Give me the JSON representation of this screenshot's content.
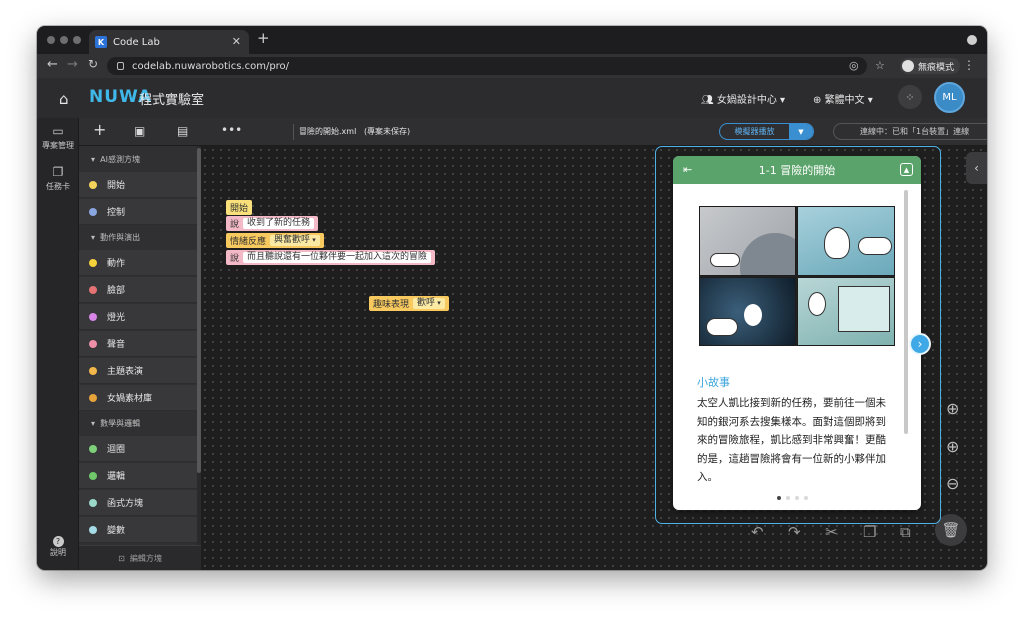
{
  "browser": {
    "tab_title": "Code Lab",
    "tab_favicon": "K",
    "url": "codelab.nuwarobotics.com/pro/",
    "incognito_label": "無痕模式"
  },
  "header": {
    "logo": "NUWA",
    "app_name": "程式實驗室",
    "design_center": "女媧設計中心",
    "language": "繁體中文",
    "avatar": "ML"
  },
  "leftnav": {
    "project_manager": "專案管理",
    "task_card": "任務卡",
    "help": "說明"
  },
  "toolbar": {
    "filename": "冒險的開始.xml",
    "unsaved": "(專案未保存)",
    "simulator": "模擬器播放",
    "connection": "連線中：已和「1台裝置」連線"
  },
  "categories": {
    "group1": "AI感測方塊",
    "group2": "動作與演出",
    "group3": "數學與邏輯",
    "items": [
      {
        "label": "開始",
        "color": "#f5d25b"
      },
      {
        "label": "控制",
        "color": "#8aa6e0"
      },
      {
        "label": "動作",
        "color": "#f4d23c"
      },
      {
        "label": "臉部",
        "color": "#e57373"
      },
      {
        "label": "燈光",
        "color": "#d985e8"
      },
      {
        "label": "聲音",
        "color": "#ee8fa8"
      },
      {
        "label": "主題表演",
        "color": "#f2b84b"
      },
      {
        "label": "女媧素材庫",
        "color": "#e6a43a"
      },
      {
        "label": "迴圈",
        "color": "#7fd07a"
      },
      {
        "label": "邏輯",
        "color": "#6fc76a"
      },
      {
        "label": "函式方塊",
        "color": "#9ad7c9"
      },
      {
        "label": "變數",
        "color": "#a4dbe6"
      }
    ],
    "edit_blocks": "編輯方塊"
  },
  "blocks": {
    "start": "開始",
    "say1_label": "說",
    "say1_value": "收到了新的任務",
    "emotion_label": "情緒反應",
    "emotion_value": "興奮歡呼",
    "say2_label": "說",
    "say2_value": "而且聽說還有一位夥伴要一起加入這次的冒險",
    "fun_label": "趣味表現",
    "fun_value": "歡呼"
  },
  "story_card": {
    "title": "1-1 冒險的開始",
    "section_title": "小故事",
    "text": "太空人凱比接到新的任務，要前往一個未知的銀河系去搜集樣本。面對這個即將到來的冒險旅程，凱比感到非常興奮！更酷的是，這趟冒險將會有一位新的小夥伴加入。",
    "page_dots": 4,
    "active_dot": 0
  }
}
